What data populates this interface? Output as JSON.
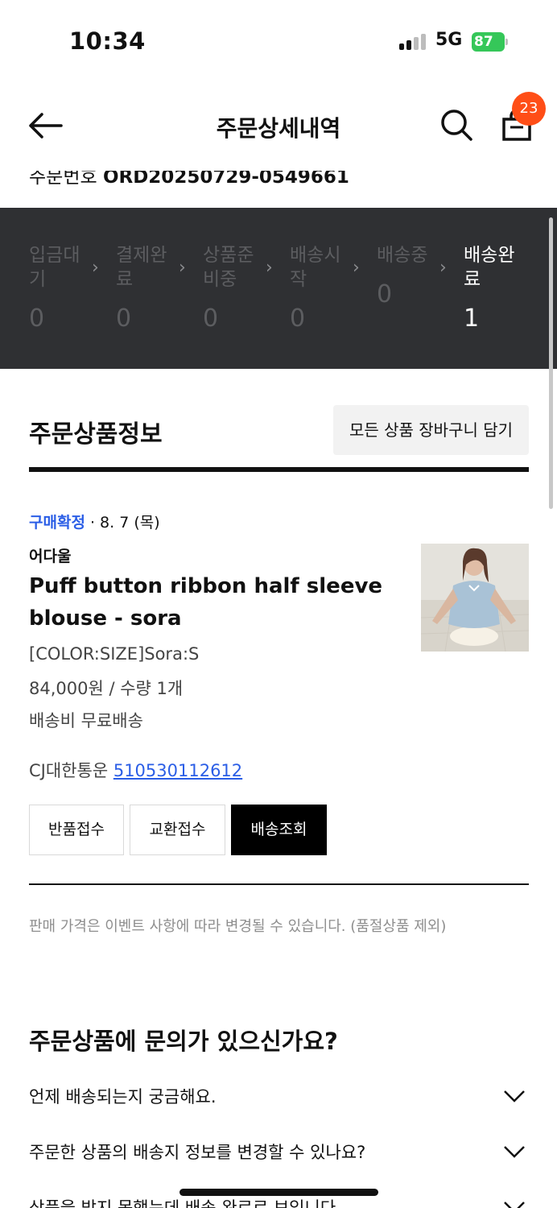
{
  "status_bar": {
    "time": "10:34",
    "network": "5G",
    "battery": "87"
  },
  "header": {
    "title": "주문상세내역",
    "cart_count": "23"
  },
  "order": {
    "number_label": "주문번호",
    "number": "ORD20250729-0549661"
  },
  "progress": {
    "steps": [
      {
        "label": "입금대기",
        "count": "0"
      },
      {
        "label": "결제완료",
        "count": "0"
      },
      {
        "label": "상품준비중",
        "count": "0"
      },
      {
        "label": "배송시작",
        "count": "0"
      },
      {
        "label": "배송중",
        "count": "0"
      },
      {
        "label": "배송완료",
        "count": "1"
      }
    ],
    "active_index": 5
  },
  "order_items": {
    "title": "주문상품정보",
    "add_all_to_cart": "모든 상품 장바구니 담기",
    "item": {
      "status": "구매확정",
      "date": "· 8. 7 (목)",
      "brand": "어다울",
      "name": "Puff button ribbon half sleeve blouse - sora",
      "option": "[COLOR:SIZE]Sora:S",
      "price_qty": "84,000원 / 수량 1개",
      "shipping": "배송비 무료배송",
      "carrier": "CJ대한통운",
      "tracking_number": "510530112612"
    },
    "buttons": {
      "return": "반품접수",
      "exchange": "교환접수",
      "track": "배송조회"
    },
    "notice": "판매 가격은 이벤트 사항에 따라 변경될 수 있습니다. (품절상품 제외)"
  },
  "faq": {
    "title": "주문상품에 문의가 있으신가요?",
    "items": [
      "언제 배송되는지 궁금해요.",
      "주문한 상품의 배송지 정보를 변경할 수 있나요?",
      "상품을 받지 못했는데 배송 완료로 보입니다."
    ]
  },
  "colors": {
    "accent_blue": "#2b5ee6",
    "badge": "#ff4e17",
    "progress_bg": "#2f3033"
  },
  "icons": [
    "back-arrow-icon",
    "search-icon",
    "shopping-bag-icon",
    "chevron-right-icon",
    "chevron-down-icon"
  ]
}
